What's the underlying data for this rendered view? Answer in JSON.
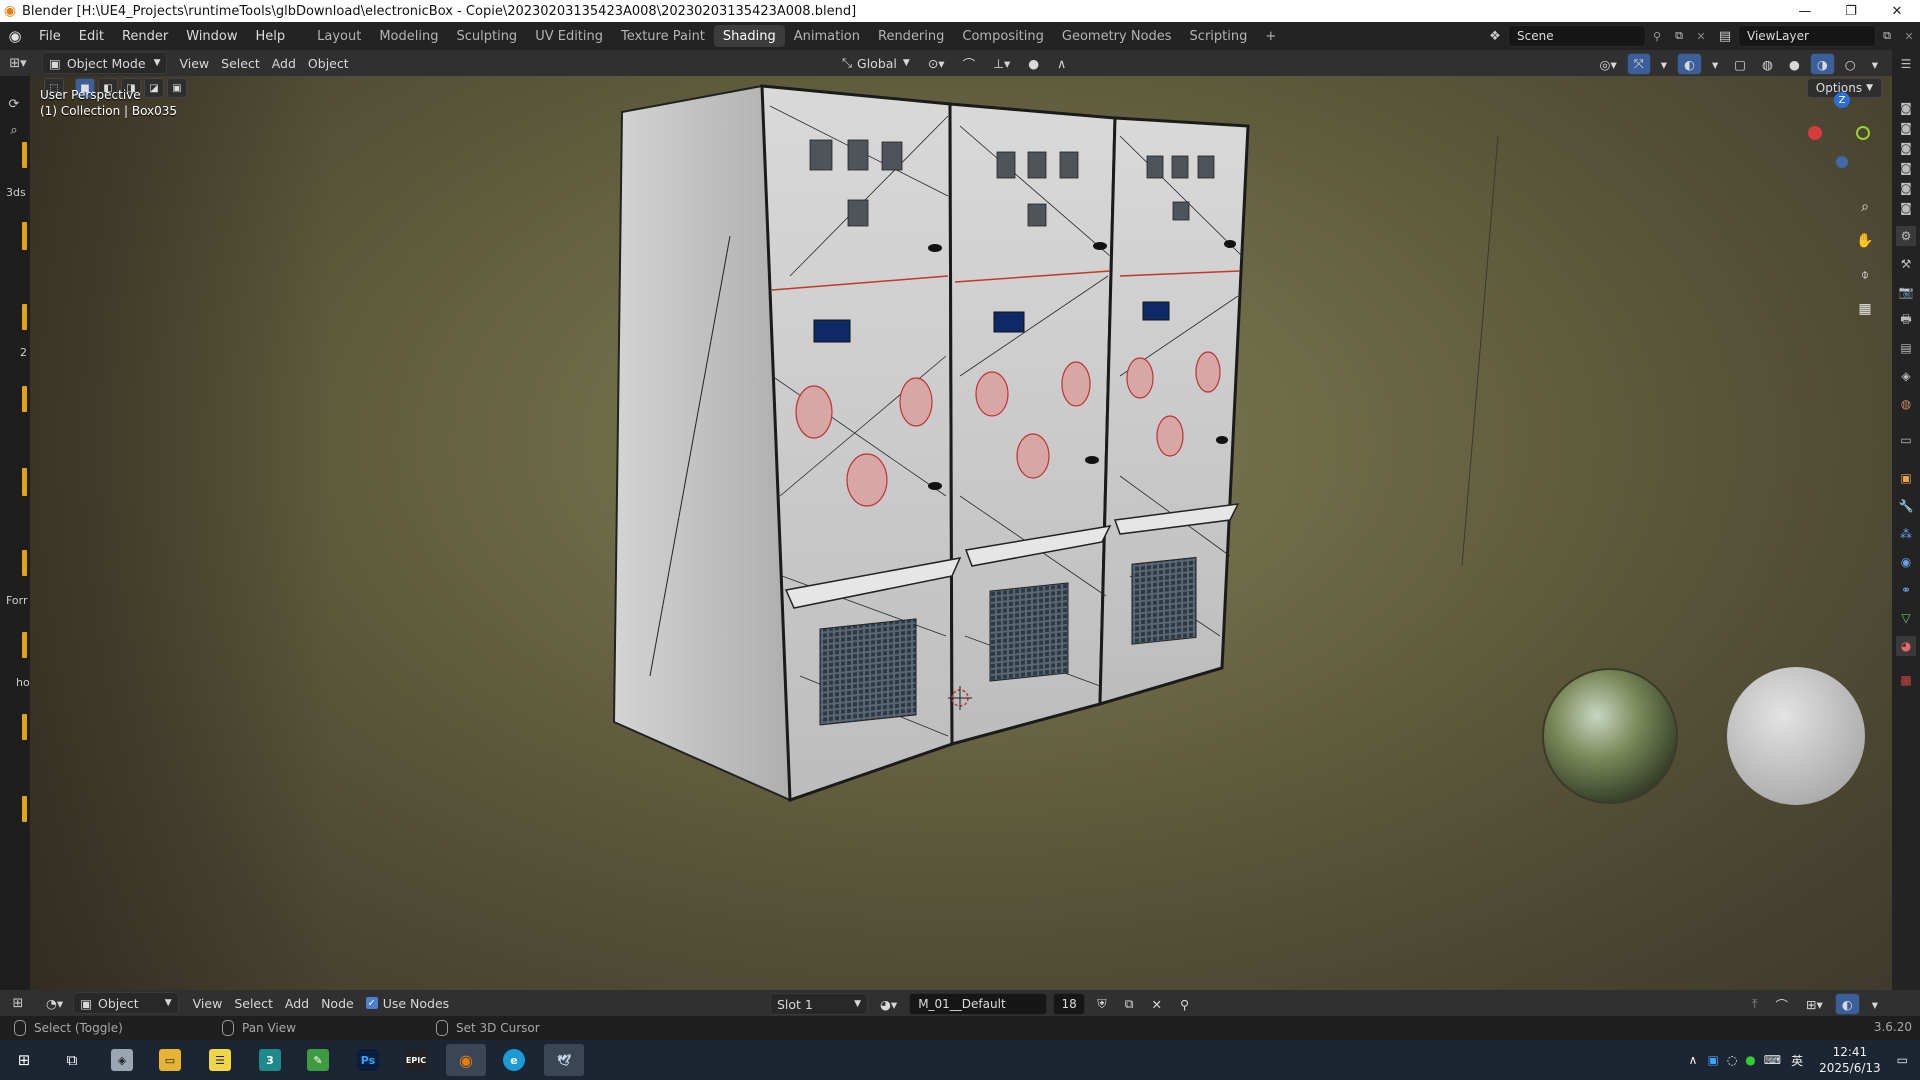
{
  "window": {
    "title": "Blender [H:\\UE4_Projects\\runtimeTools\\glbDownload\\electronicBox - Copie\\20230203135423A008\\20230203135423A008.blend]",
    "controls": [
      "minimize-icon",
      "maximize-icon",
      "close-icon"
    ]
  },
  "menu": [
    "File",
    "Edit",
    "Render",
    "Window",
    "Help"
  ],
  "workspaces": [
    {
      "label": "Layout",
      "active": false
    },
    {
      "label": "Modeling",
      "active": false
    },
    {
      "label": "Sculpting",
      "active": false
    },
    {
      "label": "UV Editing",
      "active": false
    },
    {
      "label": "Texture Paint",
      "active": false
    },
    {
      "label": "Shading",
      "active": true
    },
    {
      "label": "Animation",
      "active": false
    },
    {
      "label": "Rendering",
      "active": false
    },
    {
      "label": "Compositing",
      "active": false
    },
    {
      "label": "Geometry Nodes",
      "active": false
    },
    {
      "label": "Scripting",
      "active": false
    }
  ],
  "add_workspace": "+",
  "scene": {
    "label": "Scene"
  },
  "view_layer": {
    "label": "ViewLayer"
  },
  "viewport_header": {
    "mode": "Object Mode",
    "menus": [
      "View",
      "Select",
      "Add",
      "Object"
    ],
    "transform_orientation": "Global"
  },
  "viewport": {
    "perspective_label": "User Perspective",
    "collection_label": "(1) Collection | Box035",
    "options_label": "Options",
    "gizmo_axis": "Z"
  },
  "left_labels": [
    "3ds",
    "2",
    "Forr",
    "ho"
  ],
  "shader_header": {
    "mode": "Object",
    "menus": [
      "View",
      "Select",
      "Add",
      "Node"
    ],
    "use_nodes_label": "Use Nodes",
    "use_nodes_checked": true,
    "slot": "Slot 1",
    "material": "M_01__Default",
    "user_count": "18"
  },
  "status": {
    "select": "Select (Toggle)",
    "pan": "Pan View",
    "cursor": "Set 3D Cursor",
    "version": "3.6.20"
  },
  "taskbar": {
    "time": "12:41",
    "date": "2025/6/13",
    "ime": "英",
    "apps": [
      "start-icon",
      "task-view-icon",
      "app-icon",
      "explorer-icon",
      "notes-icon",
      "app3-icon",
      "notepad-icon",
      "photoshop-icon",
      "epic-icon",
      "blender-icon",
      "edge-icon",
      "app-bird-icon"
    ]
  },
  "colors": {
    "accent_blue": "#4a7fd4",
    "active_tab": "#3c3c3c",
    "blender_orange": "#e87d0d",
    "tool_marker": "#e3a413"
  }
}
